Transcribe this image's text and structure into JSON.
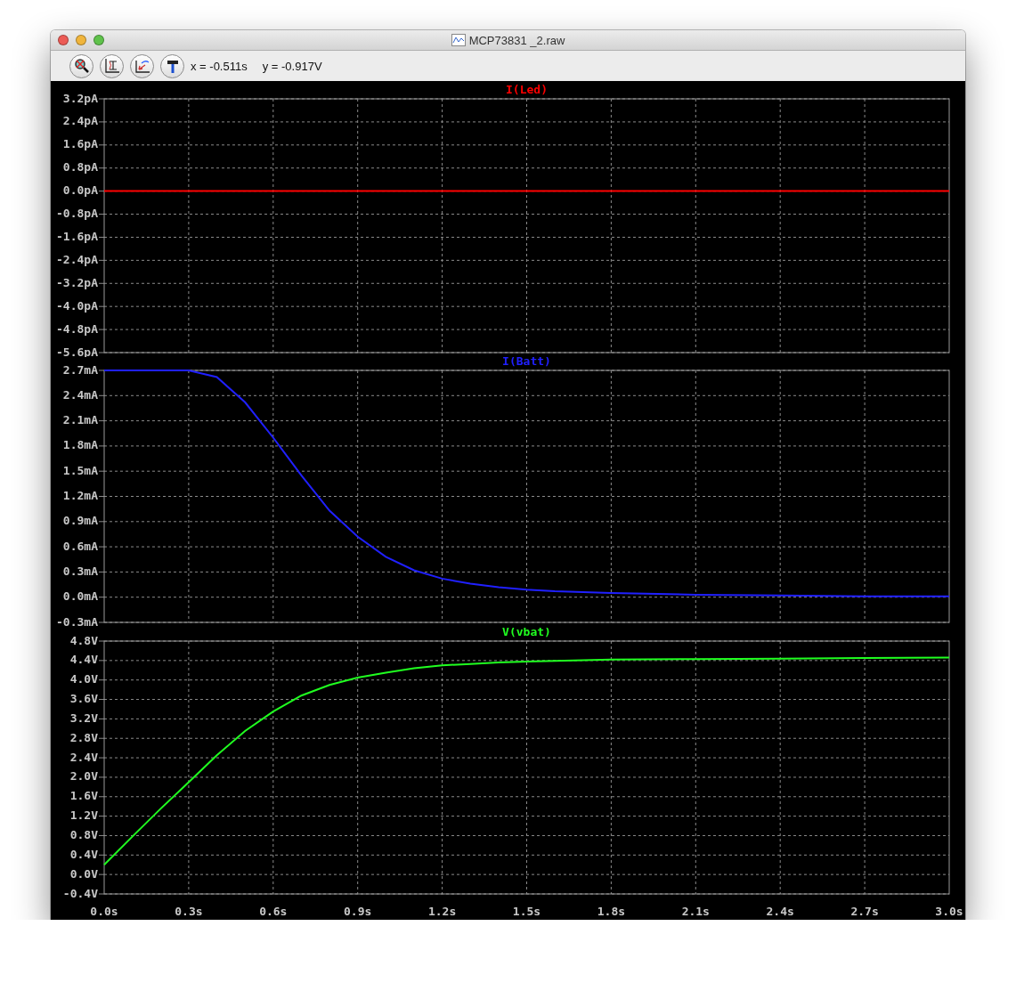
{
  "window": {
    "title": "MCP73831 _2.raw"
  },
  "toolbar": {
    "buttons": [
      {
        "kind": "zoom"
      },
      {
        "kind": "autorange"
      },
      {
        "kind": "pan"
      },
      {
        "kind": "tool"
      }
    ],
    "cursor_x": "x = -0.511s",
    "cursor_y": "y = -0.917V"
  },
  "panes": [
    {
      "chart_data": {
        "type": "line",
        "x": [
          0,
          0.3,
          0.6,
          0.9,
          1.2,
          1.5,
          1.8,
          2.1,
          2.4,
          2.7,
          3.0
        ],
        "series": [
          {
            "name": "I(Led)",
            "color": "#ff0000",
            "values": [
              0,
              0,
              0,
              0,
              0,
              0,
              0,
              0,
              0,
              0,
              0
            ]
          }
        ],
        "xlim": [
          0,
          3
        ],
        "ylim": [
          -5.6,
          3.2
        ],
        "grid": true,
        "yticks": [
          {
            "value": 3.2,
            "label": "3.2pA"
          },
          {
            "value": 2.4,
            "label": "2.4pA"
          },
          {
            "value": 1.6,
            "label": "1.6pA"
          },
          {
            "value": 0.8,
            "label": "0.8pA"
          },
          {
            "value": 0,
            "label": "0.0pA"
          },
          {
            "value": -0.8,
            "label": "-0.8pA"
          },
          {
            "value": -1.6,
            "label": "-1.6pA"
          },
          {
            "value": -2.4,
            "label": "-2.4pA"
          },
          {
            "value": -3.2,
            "label": "-3.2pA"
          },
          {
            "value": -4.0,
            "label": "-4.0pA"
          },
          {
            "value": -4.8,
            "label": "-4.8pA"
          },
          {
            "value": -5.6,
            "label": "-5.6pA"
          }
        ]
      }
    },
    {
      "chart_data": {
        "type": "line",
        "x": [
          0,
          0.1,
          0.2,
          0.3,
          0.4,
          0.5,
          0.6,
          0.7,
          0.8,
          0.9,
          1.0,
          1.1,
          1.2,
          1.3,
          1.4,
          1.5,
          1.6,
          1.8,
          2.1,
          2.4,
          2.7,
          3.0
        ],
        "series": [
          {
            "name": "I(Batt)",
            "color": "#2020ff",
            "values": [
              2.7,
              2.7,
              2.7,
              2.7,
              2.62,
              2.32,
              1.9,
              1.45,
              1.03,
              0.72,
              0.48,
              0.32,
              0.22,
              0.16,
              0.12,
              0.09,
              0.07,
              0.05,
              0.03,
              0.02,
              0.01,
              0.01
            ]
          }
        ],
        "xlim": [
          0,
          3
        ],
        "ylim": [
          -0.3,
          2.7
        ],
        "grid": true,
        "yticks": [
          {
            "value": 2.7,
            "label": "2.7mA"
          },
          {
            "value": 2.4,
            "label": "2.4mA"
          },
          {
            "value": 2.1,
            "label": "2.1mA"
          },
          {
            "value": 1.8,
            "label": "1.8mA"
          },
          {
            "value": 1.5,
            "label": "1.5mA"
          },
          {
            "value": 1.2,
            "label": "1.2mA"
          },
          {
            "value": 0.9,
            "label": "0.9mA"
          },
          {
            "value": 0.6,
            "label": "0.6mA"
          },
          {
            "value": 0.3,
            "label": "0.3mA"
          },
          {
            "value": 0,
            "label": "0.0mA"
          },
          {
            "value": -0.3,
            "label": "-0.3mA"
          }
        ]
      }
    },
    {
      "chart_data": {
        "type": "line",
        "x": [
          0,
          0.1,
          0.2,
          0.3,
          0.4,
          0.5,
          0.6,
          0.7,
          0.8,
          0.9,
          1.0,
          1.1,
          1.2,
          1.3,
          1.4,
          1.5,
          1.8,
          2.1,
          2.4,
          2.7,
          3.0
        ],
        "series": [
          {
            "name": "V(vbat)",
            "color": "#20ff20",
            "values": [
              0.2,
              0.78,
              1.35,
              1.9,
              2.45,
              2.95,
              3.35,
              3.68,
              3.9,
              4.05,
              4.15,
              4.24,
              4.3,
              4.33,
              4.36,
              4.38,
              4.42,
              4.43,
              4.44,
              4.45,
              4.46
            ]
          }
        ],
        "xlim": [
          0,
          3
        ],
        "ylim": [
          -0.4,
          4.8
        ],
        "grid": true,
        "xticks": [
          {
            "value": 0,
            "label": "0.0s"
          },
          {
            "value": 0.3,
            "label": "0.3s"
          },
          {
            "value": 0.6,
            "label": "0.6s"
          },
          {
            "value": 0.9,
            "label": "0.9s"
          },
          {
            "value": 1.2,
            "label": "1.2s"
          },
          {
            "value": 1.5,
            "label": "1.5s"
          },
          {
            "value": 1.8,
            "label": "1.8s"
          },
          {
            "value": 2.1,
            "label": "2.1s"
          },
          {
            "value": 2.4,
            "label": "2.4s"
          },
          {
            "value": 2.7,
            "label": "2.7s"
          },
          {
            "value": 3.0,
            "label": "3.0s"
          }
        ],
        "yticks": [
          {
            "value": 4.8,
            "label": "4.8V"
          },
          {
            "value": 4.4,
            "label": "4.4V"
          },
          {
            "value": 4.0,
            "label": "4.0V"
          },
          {
            "value": 3.6,
            "label": "3.6V"
          },
          {
            "value": 3.2,
            "label": "3.2V"
          },
          {
            "value": 2.8,
            "label": "2.8V"
          },
          {
            "value": 2.4,
            "label": "2.4V"
          },
          {
            "value": 2.0,
            "label": "2.0V"
          },
          {
            "value": 1.6,
            "label": "1.6V"
          },
          {
            "value": 1.2,
            "label": "1.2V"
          },
          {
            "value": 0.8,
            "label": "0.8V"
          },
          {
            "value": 0.4,
            "label": "0.4V"
          },
          {
            "value": 0,
            "label": "0.0V"
          },
          {
            "value": -0.4,
            "label": "-0.4V"
          }
        ]
      }
    }
  ]
}
